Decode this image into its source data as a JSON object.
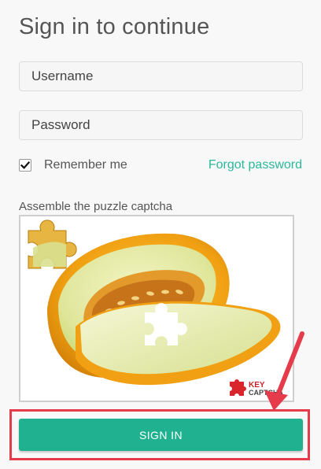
{
  "title": "Sign in to continue",
  "username": {
    "placeholder": "Username"
  },
  "password": {
    "placeholder": "Password"
  },
  "remember": {
    "label": "Remember me",
    "checked": true
  },
  "forgot_label": "Forgot password",
  "captcha": {
    "label": "Assemble the puzzle captcha",
    "logo_line1": "KEY",
    "logo_line2": "CAPTCHA"
  },
  "signin_label": "SIGN IN",
  "colors": {
    "accent": "#20b290",
    "link": "#2bb89a",
    "highlight": "#e53b4a"
  }
}
